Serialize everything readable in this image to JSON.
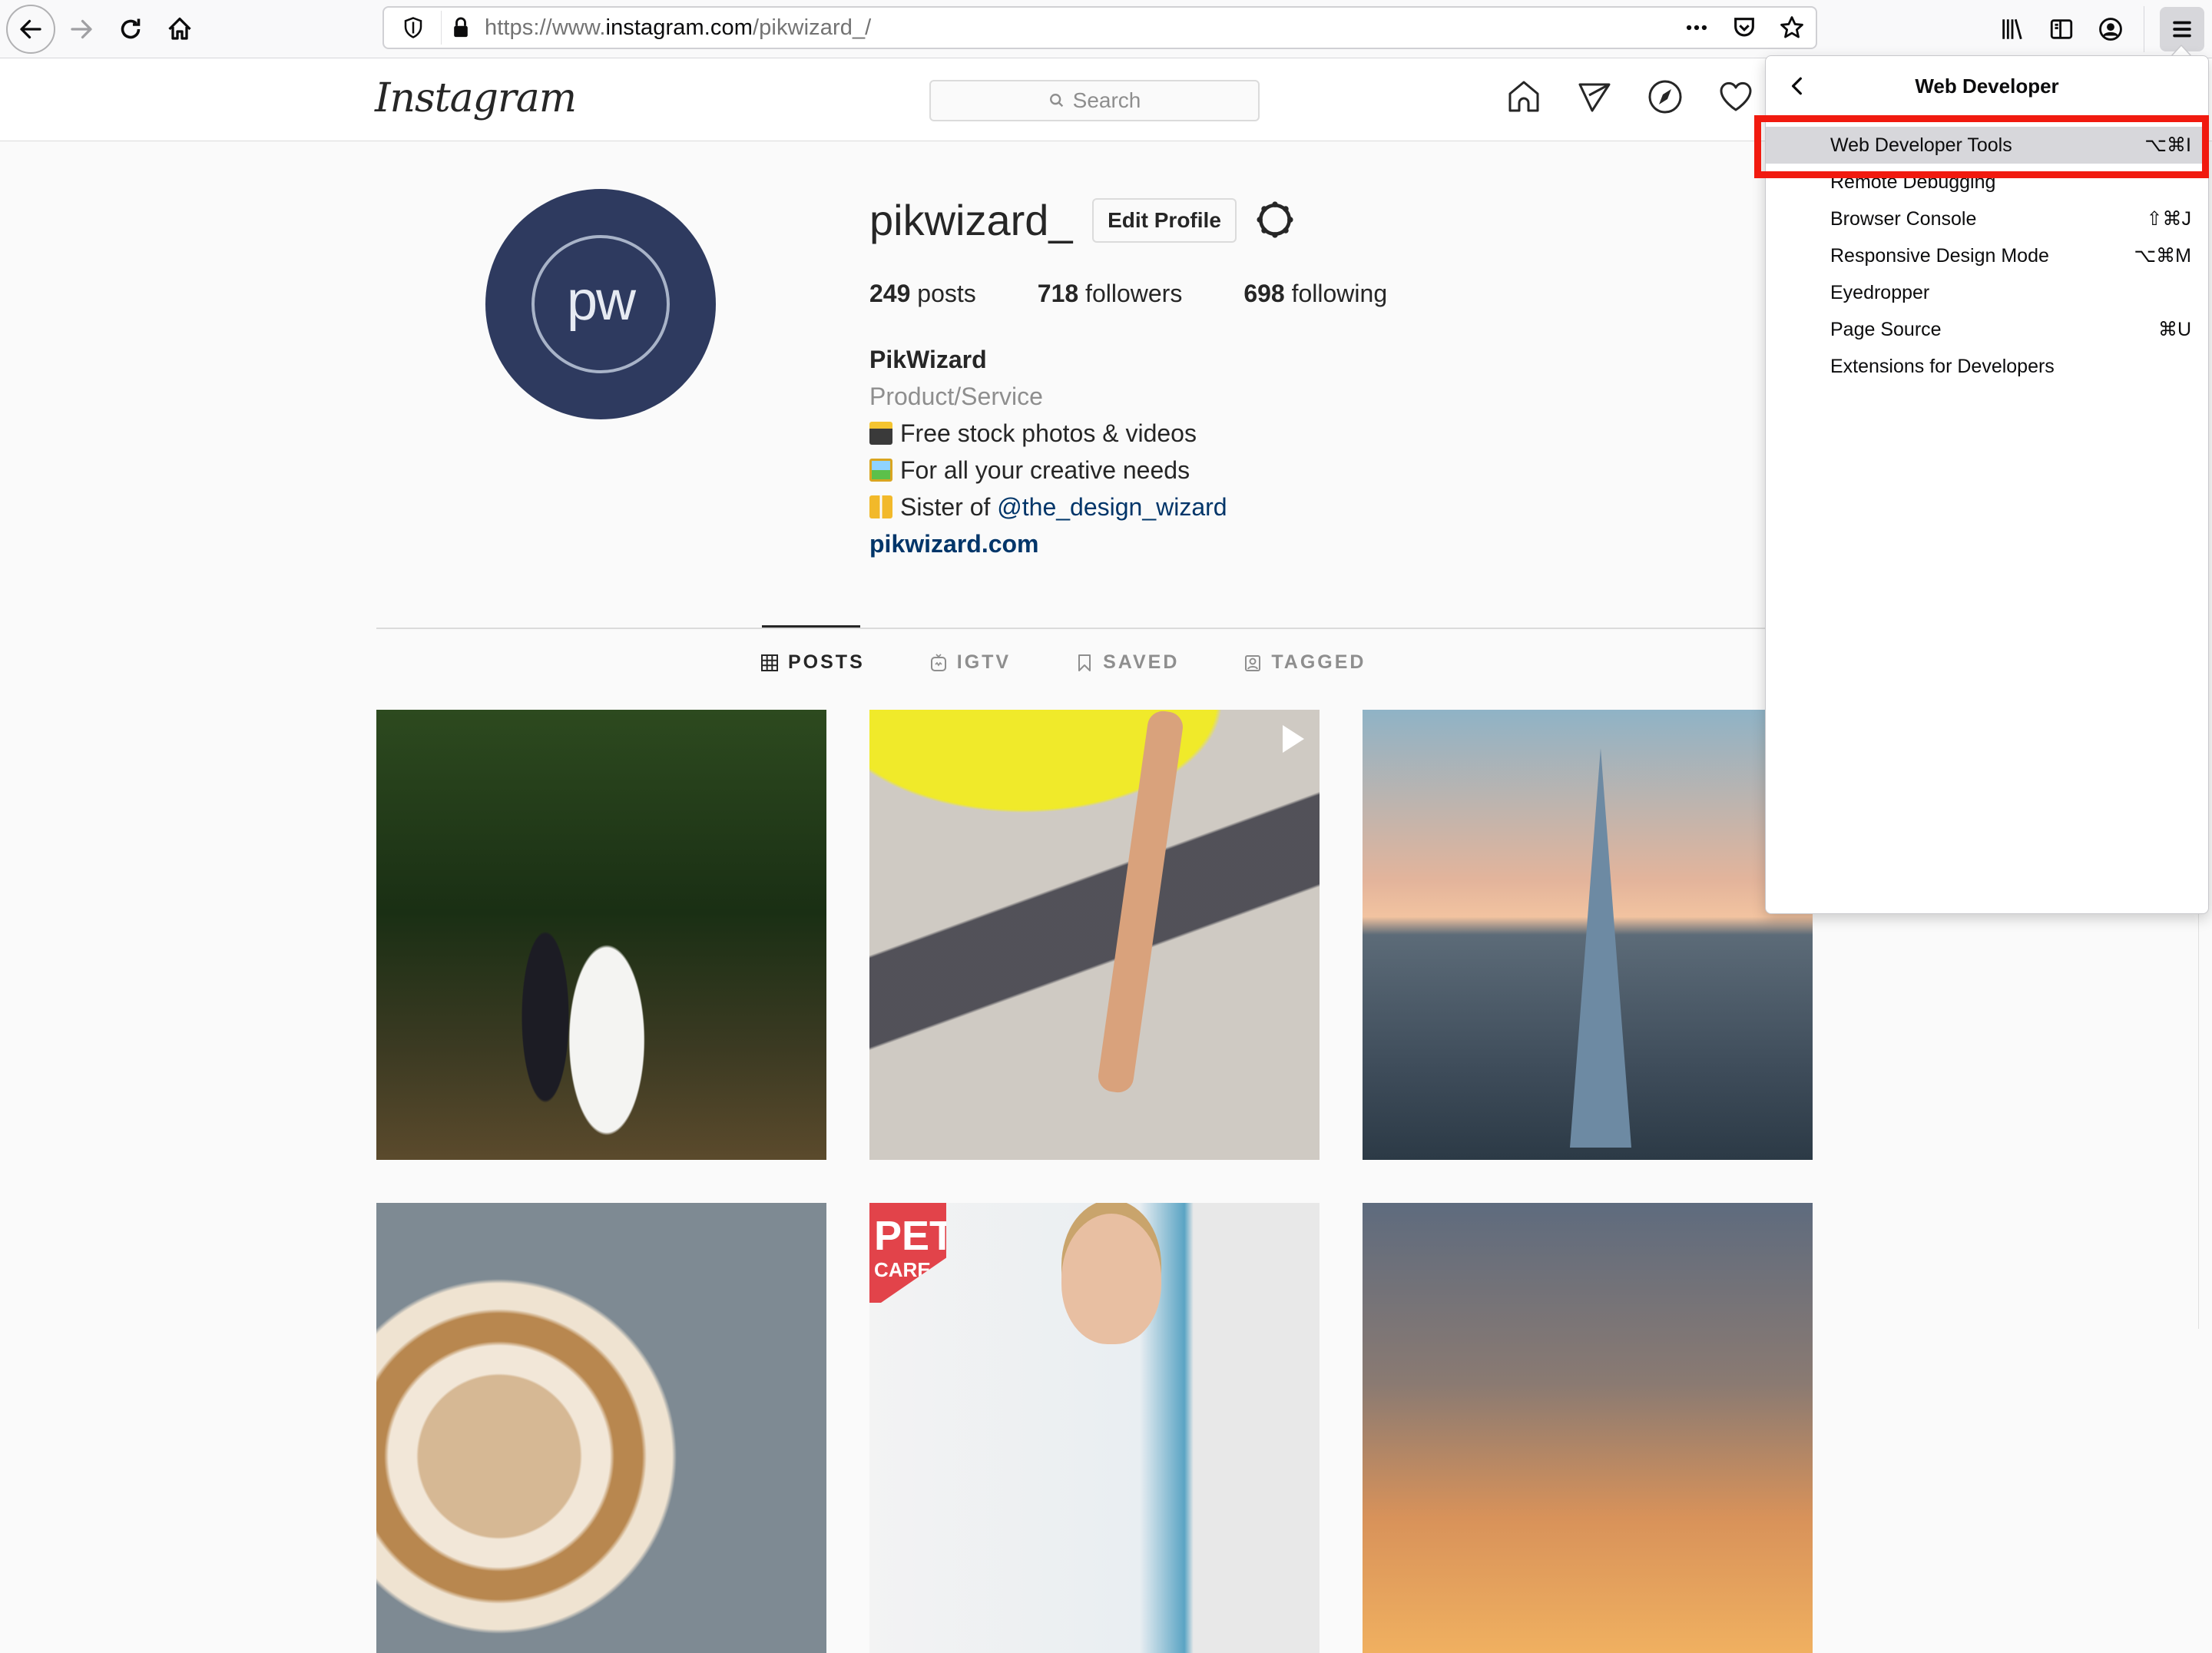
{
  "browser": {
    "url_prefix": "https://www.",
    "url_host": "instagram.com",
    "url_path": "/pikwizard_/",
    "icons": {
      "back": "back-arrow-icon",
      "forward": "forward-arrow-icon",
      "reload": "reload-icon",
      "home": "home-icon",
      "tracking": "shield-icon",
      "lock": "lock-icon",
      "page_actions": "more-dots-icon",
      "pocket": "pocket-icon",
      "bookmark": "star-icon",
      "library": "library-icon",
      "sidebar": "sidebar-icon",
      "account": "account-icon",
      "menu": "hamburger-menu-icon"
    }
  },
  "instagram": {
    "logo": "Instagram",
    "search_placeholder": "Search",
    "nav_icons": [
      "home-icon",
      "direct-message-icon",
      "explore-compass-icon",
      "activity-heart-icon"
    ]
  },
  "profile": {
    "avatar_text": "pw",
    "username": "pikwizard_",
    "edit_profile_label": "Edit Profile",
    "stats": [
      {
        "count": "249",
        "label": "posts"
      },
      {
        "count": "718",
        "label": "followers"
      },
      {
        "count": "698",
        "label": "following"
      }
    ],
    "full_name": "PikWizard",
    "category": "Product/Service",
    "bio_lines": [
      {
        "emoji": "camera-flash-emoji",
        "text": "Free stock photos & videos"
      },
      {
        "emoji": "framed-picture-emoji",
        "text": "For all your creative needs"
      },
      {
        "emoji": "women-bunny-ears-emoji",
        "text": "Sister of ",
        "mention": "@the_design_wizard"
      }
    ],
    "website": "pikwizard.com"
  },
  "tabs": [
    {
      "label": "POSTS",
      "icon": "grid-icon",
      "active": true
    },
    {
      "label": "IGTV",
      "icon": "igtv-icon",
      "active": false
    },
    {
      "label": "SAVED",
      "icon": "bookmark-icon",
      "active": false
    },
    {
      "label": "TAGGED",
      "icon": "tagged-user-icon",
      "active": false
    }
  ],
  "posts": [
    {
      "subject": "wedding couple walking in forest"
    },
    {
      "subject": "surfer carrying yellow surfboard",
      "is_video": true
    },
    {
      "subject": "The Shard London skyline at sunset"
    },
    {
      "subject": "latte art coffee"
    },
    {
      "subject": "pet care vet woman",
      "overlay_text_1": "PET",
      "overlay_text_2": "CARE"
    },
    {
      "subject": "sunset clouds sky"
    }
  ],
  "menu": {
    "title": "Web Developer",
    "items": [
      {
        "label": "Web Developer Tools",
        "shortcut": "⌥⌘I",
        "highlighted": true
      },
      {
        "label": "Remote Debugging",
        "shortcut": ""
      },
      {
        "label": "Browser Console",
        "shortcut": "⇧⌘J"
      },
      {
        "label": "Responsive Design Mode",
        "shortcut": "⌥⌘M"
      },
      {
        "label": "Eyedropper",
        "shortcut": ""
      },
      {
        "label": "Page Source",
        "shortcut": "⌘U"
      },
      {
        "label": "Extensions for Developers",
        "shortcut": ""
      }
    ],
    "annotation_color": "#f11a0f"
  }
}
